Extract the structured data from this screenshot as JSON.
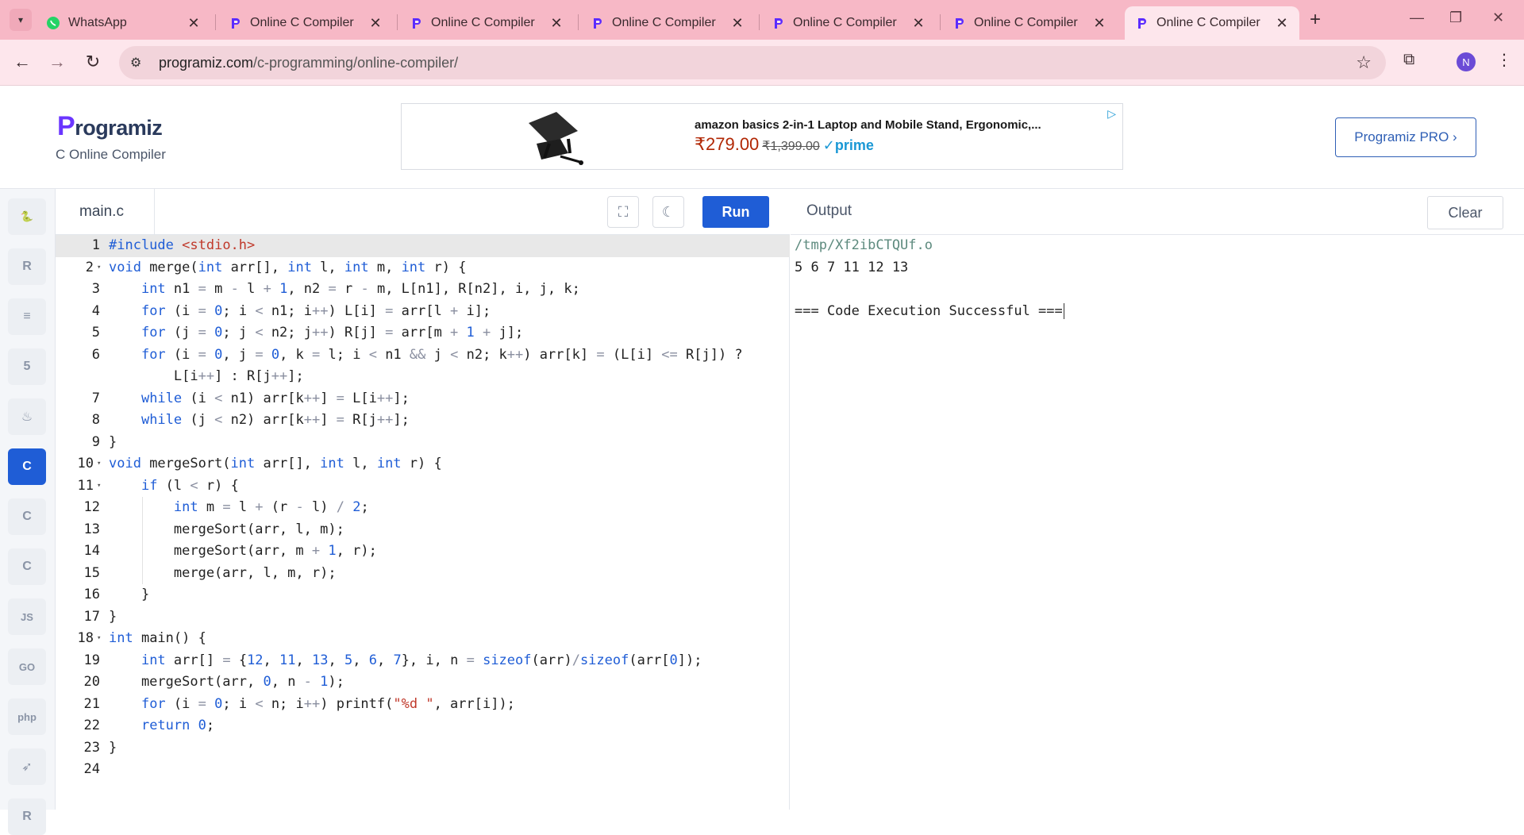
{
  "browser": {
    "tabs": [
      {
        "title": "WhatsApp",
        "icon": "whatsapp-icon",
        "active": false
      },
      {
        "title": "Online C Compiler",
        "icon": "programiz-icon",
        "active": false
      },
      {
        "title": "Online C Compiler",
        "icon": "programiz-icon",
        "active": false
      },
      {
        "title": "Online C Compiler",
        "icon": "programiz-icon",
        "active": false
      },
      {
        "title": "Online C Compiler",
        "icon": "programiz-icon",
        "active": false
      },
      {
        "title": "Online C Compiler",
        "icon": "programiz-icon",
        "active": false
      },
      {
        "title": "Online C Compiler",
        "icon": "programiz-icon",
        "active": true
      }
    ],
    "url_host": "programiz.com",
    "url_path": "/c-programming/online-compiler/",
    "profile_initial": "N",
    "colors": {
      "tabbar": "#f7b8c6",
      "toolbar": "#fde6ec"
    }
  },
  "site": {
    "logo_text": "rogramiz",
    "logo_letter": "P",
    "subtitle": "C Online Compiler",
    "pro_button": "Programiz PRO ›",
    "ad": {
      "title": "amazon basics 2-in-1 Laptop and Mobile Stand, Ergonomic,...",
      "price": "₹279.00",
      "old_price": "₹1,399.00",
      "prime": "✓prime"
    }
  },
  "languages": [
    {
      "name": "python-icon",
      "glyph": "🐍",
      "active": false
    },
    {
      "name": "r-icon",
      "glyph": "R",
      "active": false
    },
    {
      "name": "sql-icon",
      "glyph": "≡",
      "active": false
    },
    {
      "name": "html5-icon",
      "glyph": "5",
      "active": false
    },
    {
      "name": "java-icon",
      "glyph": "♨",
      "active": false
    },
    {
      "name": "c-icon",
      "glyph": "C",
      "active": true
    },
    {
      "name": "cpp-icon",
      "glyph": "C",
      "active": false
    },
    {
      "name": "csharp-icon",
      "glyph": "C",
      "active": false
    },
    {
      "name": "javascript-icon",
      "glyph": "JS",
      "active": false
    },
    {
      "name": "go-icon",
      "glyph": "GO",
      "active": false
    },
    {
      "name": "php-icon",
      "glyph": "php",
      "active": false
    },
    {
      "name": "swift-icon",
      "glyph": "➶",
      "active": false
    },
    {
      "name": "rust-icon",
      "glyph": "R",
      "active": false
    }
  ],
  "editor": {
    "filename": "main.c",
    "run_label": "Run",
    "line_numbers": [
      "1",
      "2",
      "3",
      "4",
      "5",
      "6",
      "7",
      "8",
      "9",
      "10",
      "11",
      "12",
      "13",
      "14",
      "15",
      "16",
      "17",
      "18",
      "19",
      "20",
      "21",
      "22",
      "23",
      "24"
    ],
    "fold_lines": [
      "2",
      "10",
      "11",
      "18"
    ],
    "code_lines": [
      "#include <stdio.h>",
      "void merge(int arr[], int l, int m, int r) {",
      "    int n1 = m - l + 1, n2 = r - m, L[n1], R[n2], i, j, k;",
      "    for (i = 0; i < n1; i++) L[i] = arr[l + i];",
      "    for (j = 0; j < n2; j++) R[j] = arr[m + 1 + j];",
      "    for (i = 0, j = 0, k = l; i < n1 && j < n2; k++) arr[k] = (L[i] <= R[j]) ?",
      "        L[i++] : R[j++];",
      "    while (i < n1) arr[k++] = L[i++];",
      "    while (j < n2) arr[k++] = R[j++];",
      "}",
      "void mergeSort(int arr[], int l, int r) {",
      "    if (l < r) {",
      "        int m = l + (r - l) / 2;",
      "        mergeSort(arr, l, m);",
      "        mergeSort(arr, m + 1, r);",
      "        merge(arr, l, m, r);",
      "    }",
      "}",
      "int main() {",
      "    int arr[] = {12, 11, 13, 5, 6, 7}, i, n = sizeof(arr)/sizeof(arr[0]);",
      "    mergeSort(arr, 0, n - 1);",
      "    for (i = 0; i < n; i++) printf(\"%d \", arr[i]);",
      "    return 0;",
      "}",
      ""
    ]
  },
  "output": {
    "title": "Output",
    "clear_label": "Clear",
    "lines": [
      "/tmp/Xf2ibCTQUf.o",
      "5 6 7 11 12 13",
      "",
      "=== Code Execution Successful ==="
    ]
  }
}
